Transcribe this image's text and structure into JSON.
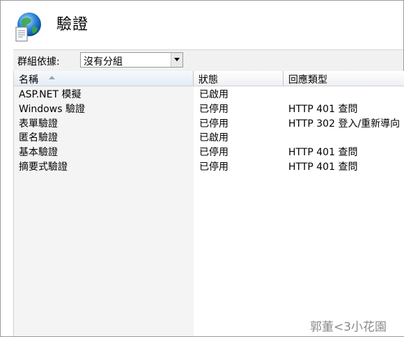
{
  "header": {
    "title": "驗證"
  },
  "group_by": {
    "label": "群組依據:",
    "value": "沒有分組"
  },
  "columns": {
    "name": "名稱",
    "status": "狀態",
    "response": "回應類型"
  },
  "rows": [
    {
      "name": "ASP.NET 模擬",
      "status": "已啟用",
      "response": ""
    },
    {
      "name": "Windows 驗證",
      "status": "已停用",
      "response": "HTTP 401 查問"
    },
    {
      "name": "表單驗證",
      "status": "已停用",
      "response": "HTTP 302 登入/重新導向"
    },
    {
      "name": "匿名驗證",
      "status": "已啟用",
      "response": ""
    },
    {
      "name": "基本驗證",
      "status": "已停用",
      "response": "HTTP 401 查問"
    },
    {
      "name": "摘要式驗證",
      "status": "已停用",
      "response": "HTTP 401 查問"
    }
  ],
  "watermark": "郭董<3小花園",
  "icons": {
    "page_icon": "globe-document-icon",
    "dropdown": "chevron-down-icon",
    "sort": "sort-ascending-icon"
  },
  "colors": {
    "sorted_column_header": "#e3ecf5",
    "sorted_column_bg": "#f4f4f4",
    "header_border": "#c5c5c5"
  }
}
